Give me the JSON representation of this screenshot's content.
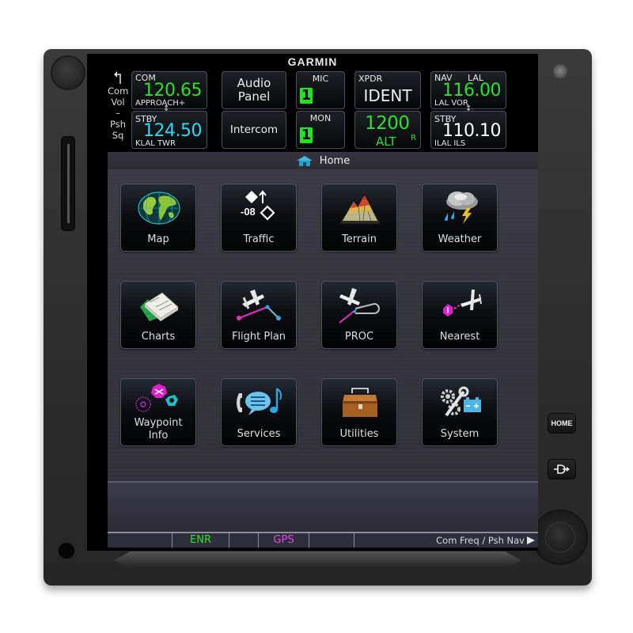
{
  "device": {
    "brand": "GARMIN",
    "hardware_buttons": {
      "home_label": "HOME",
      "direct_to_symbol": "-D▸"
    }
  },
  "top_bar": {
    "side_hint": {
      "lines": [
        "Com",
        "Vol",
        "–",
        "Psh",
        "Sq"
      ]
    },
    "com": {
      "active_label": "COM",
      "active_freq": "120.65",
      "active_name": "APPROACH+",
      "standby_label": "STBY",
      "standby_freq": "124.50",
      "standby_name": "KLAL TWR",
      "swap_symbol": "⇕"
    },
    "audio_panel_label": "Audio Panel",
    "intercom_label": "Intercom",
    "mic": {
      "label": "MIC",
      "value": "1"
    },
    "mon": {
      "label": "MON",
      "value": "1"
    },
    "xpdr": {
      "label": "XPDR",
      "ident_label": "IDENT",
      "code": "1200",
      "mode": "ALT",
      "reply": "R"
    },
    "nav": {
      "active_label": "NAV",
      "active_id": "LAL",
      "active_freq": "116.00",
      "active_name": "LAL VOR",
      "standby_label": "STBY",
      "standby_freq": "110.10",
      "standby_name": "ILAL ILS",
      "swap_symbol": "⇕"
    }
  },
  "home": {
    "title": "Home",
    "icon": "home-icon",
    "apps": [
      {
        "label": "Map",
        "icon": "globe-icon"
      },
      {
        "label": "Traffic",
        "icon": "traffic-icon",
        "traffic_alt": "-08"
      },
      {
        "label": "Terrain",
        "icon": "terrain-icon"
      },
      {
        "label": "Weather",
        "icon": "weather-icon"
      },
      {
        "label": "Charts",
        "icon": "charts-icon"
      },
      {
        "label": "Flight Plan",
        "icon": "flight-plan-icon"
      },
      {
        "label": "PROC",
        "icon": "procedure-icon"
      },
      {
        "label": "Nearest",
        "icon": "nearest-icon"
      },
      {
        "label": "Waypoint Info",
        "label_line1": "Waypoint",
        "label_line2": "Info",
        "icon": "waypoint-info-icon"
      },
      {
        "label": "Services",
        "icon": "services-icon"
      },
      {
        "label": "Utilities",
        "icon": "toolbox-icon"
      },
      {
        "label": "System",
        "icon": "system-icon"
      }
    ]
  },
  "status_bar": {
    "segments": [
      "",
      "ENR",
      "",
      "GPS",
      "",
      ""
    ],
    "flight_phase": "ENR",
    "nav_source": "GPS",
    "knob_hint": "Com Freq / Psh Nav",
    "colors": {
      "flight_phase": "#29e22b",
      "nav_source": "#e04ae6"
    }
  },
  "colors": {
    "active_freq": "#29e22b",
    "standby_freq": "#2ad9f2",
    "selected_box": "#1ee61c"
  }
}
